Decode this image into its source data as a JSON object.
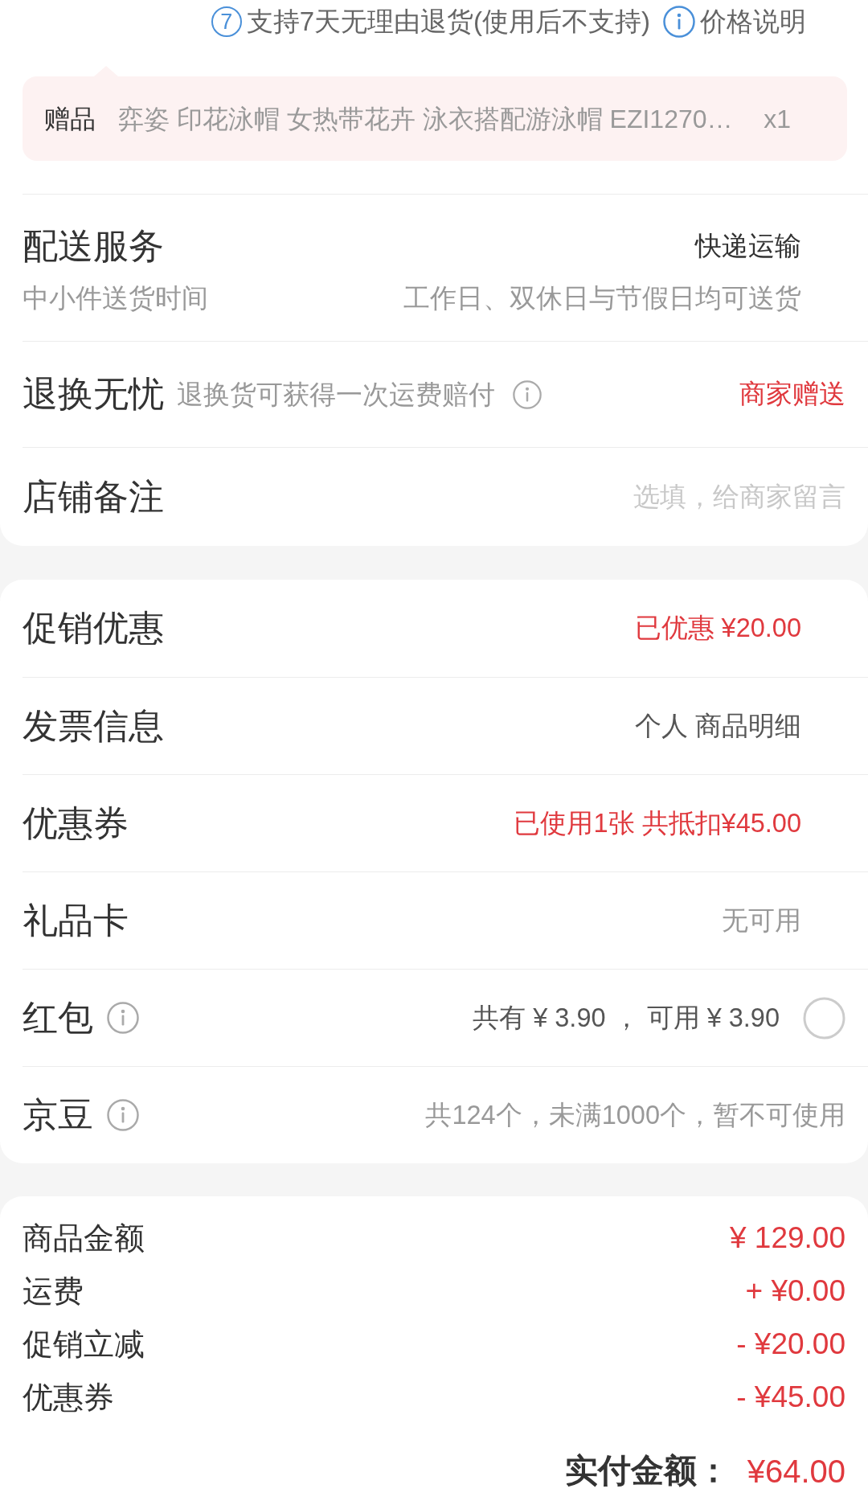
{
  "service_notes": [
    {
      "kind": "days",
      "badge": "7",
      "text": "支持7天无理由退货(使用后不支持)"
    },
    {
      "kind": "info",
      "text": "价格说明"
    }
  ],
  "gift": {
    "label": "赠品",
    "name": "弈姿 印花泳帽 女热带花卉 泳衣搭配游泳帽 EZI1270…",
    "quantity": "x1"
  },
  "order_options": [
    {
      "kind": "detail",
      "title": "配送服务",
      "value": "快递运输",
      "highlight": false,
      "subtitle": "中小件送货时间",
      "subvalue": "工作日、双休日与节假日均可送货"
    },
    {
      "kind": "info",
      "title": "退换无忧",
      "note": "退换货可获得一次运费赔付",
      "value": "商家赠送",
      "highlight": true
    },
    {
      "kind": "input",
      "title": "店铺备注",
      "placeholder": "选填，给商家留言"
    }
  ],
  "discounts": [
    {
      "kind": "link",
      "title": "促销优惠",
      "value": "已优惠 ¥20.00",
      "highlight": true,
      "disabled": false,
      "info_icon": false
    },
    {
      "kind": "link",
      "title": "发票信息",
      "value": "个人 商品明细",
      "highlight": false,
      "disabled": false,
      "info_icon": false
    },
    {
      "kind": "link",
      "title": "优惠券",
      "value": "已使用1张 共抵扣¥45.00",
      "highlight": true,
      "disabled": false,
      "info_icon": false
    },
    {
      "kind": "link",
      "title": "礼品卡",
      "value": "无可用",
      "highlight": false,
      "disabled": true,
      "info_icon": false
    },
    {
      "kind": "toggle",
      "title": "红包",
      "value": "共有 ¥ 3.90 ， 可用 ¥ 3.90",
      "highlight": false,
      "disabled": false,
      "info_icon": true,
      "checked": false
    },
    {
      "kind": "plain",
      "title": "京豆",
      "value": "共124个，未满1000个，暂不可使用",
      "highlight": false,
      "disabled": true,
      "info_icon": true
    }
  ],
  "summary": {
    "lines": [
      {
        "label": "商品金额",
        "value": "¥ 129.00"
      },
      {
        "label": "运费",
        "value": "+ ¥0.00"
      },
      {
        "label": "促销立减",
        "value": "- ¥20.00"
      },
      {
        "label": "优惠券",
        "value": "- ¥45.00"
      }
    ],
    "total": {
      "label": "实付金额：",
      "value": "¥64.00"
    }
  }
}
